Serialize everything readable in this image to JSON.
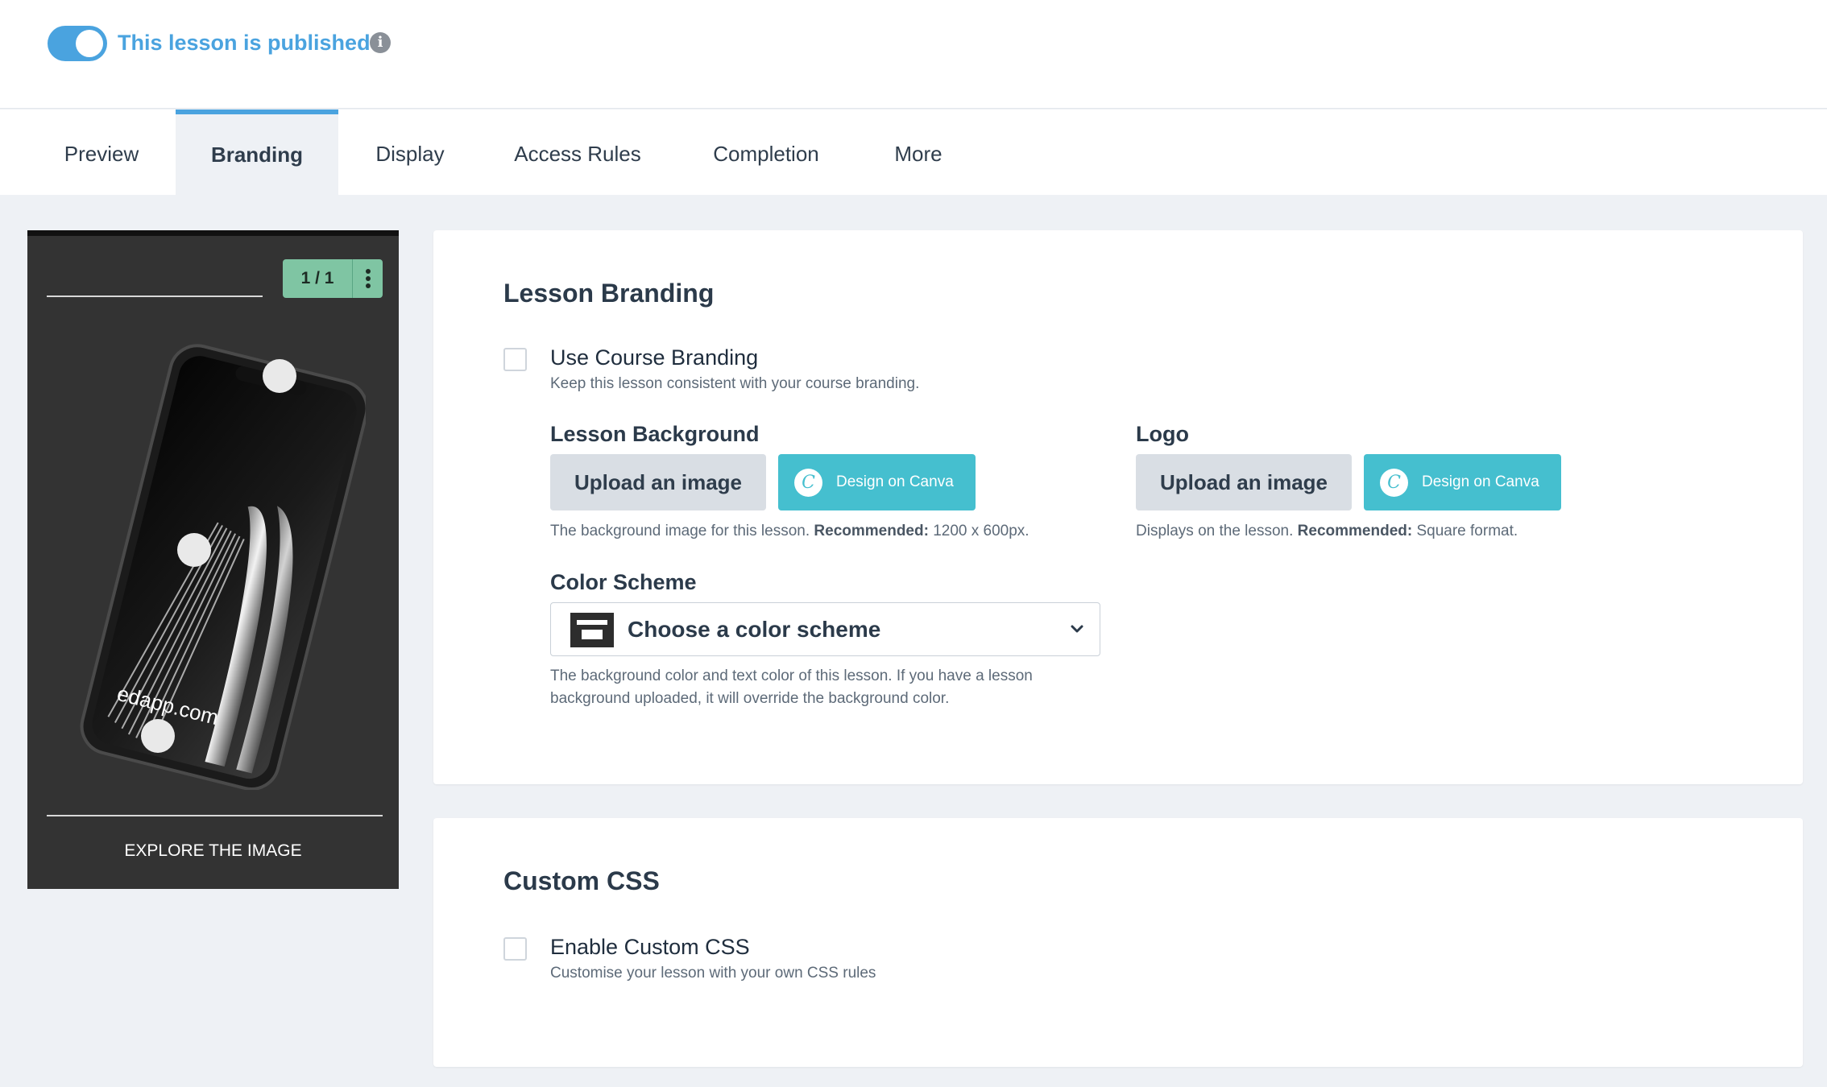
{
  "publish": {
    "label": "This lesson is published",
    "enabled": true,
    "info_glyph": "i"
  },
  "tabs": [
    {
      "label": "Preview",
      "active": false
    },
    {
      "label": "Branding",
      "active": true
    },
    {
      "label": "Display",
      "active": false
    },
    {
      "label": "Access Rules",
      "active": false
    },
    {
      "label": "Completion",
      "active": false
    },
    {
      "label": "More",
      "active": false
    }
  ],
  "preview": {
    "counter": "1 / 1",
    "watermark": "edapp.com",
    "explore_label": "EXPLORE THE IMAGE"
  },
  "branding": {
    "title": "Lesson Branding",
    "use_course": {
      "label": "Use Course Branding",
      "description": "Keep this lesson consistent with your course branding.",
      "checked": false
    },
    "background": {
      "label": "Lesson Background",
      "upload_label": "Upload an image",
      "canva_label": "Design on Canva",
      "canva_glyph": "C",
      "help_prefix": "The background image for this lesson.",
      "help_bold": "Recommended:",
      "help_suffix": "1200 x 600px."
    },
    "logo": {
      "label": "Logo",
      "upload_label": "Upload an image",
      "canva_label": "Design on Canva",
      "canva_glyph": "C",
      "help_prefix": "Displays on the lesson.",
      "help_bold": "Recommended:",
      "help_suffix": "Square format."
    },
    "color_scheme": {
      "label": "Color Scheme",
      "selected": "Choose a color scheme",
      "help_line1": "The background color and text color of this lesson. If you have a lesson",
      "help_line2": "background uploaded, it will override the background color."
    }
  },
  "custom_css": {
    "title": "Custom CSS",
    "enable": {
      "label": "Enable Custom CSS",
      "description": "Customise your lesson with your own CSS rules",
      "checked": false
    }
  },
  "colors": {
    "accent": "#4aa3df",
    "canva": "#45bfcf",
    "counter_badge": "#7fc5a3",
    "preview_bg": "#333333"
  }
}
